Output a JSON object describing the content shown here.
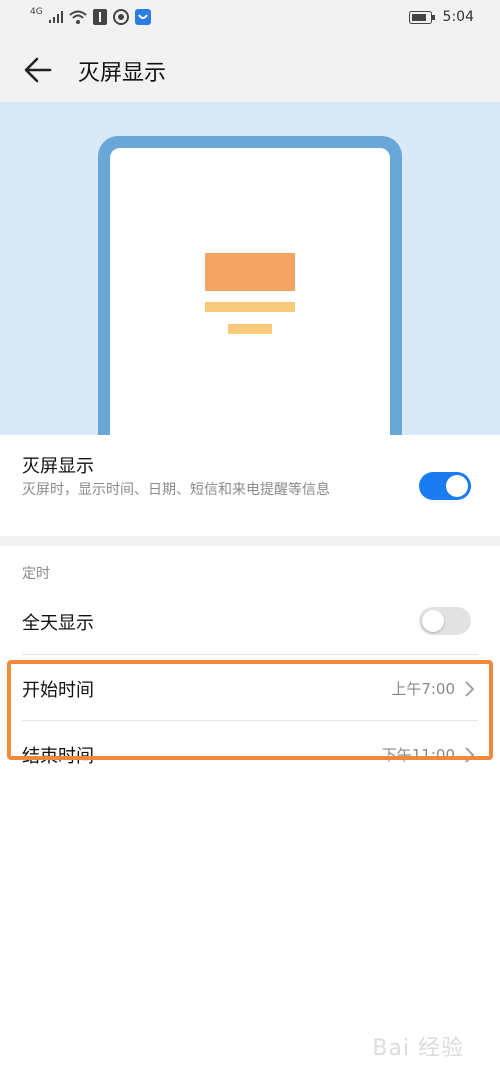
{
  "status_bar": {
    "network": "4G",
    "time": "5:04"
  },
  "header": {
    "title": "灭屏显示",
    "back_icon": "arrow-left-icon"
  },
  "preview": {
    "colors": {
      "background": "#dae9f7",
      "frame": "#69a7d8",
      "block_main": "#f5a563",
      "block_bars": "#f9c97c"
    }
  },
  "aod_setting": {
    "title": "灭屏显示",
    "description": "灭屏时，显示时间、日期、短信和来电提醒等信息",
    "enabled": true
  },
  "schedule": {
    "section_label": "定时",
    "all_day": {
      "label": "全天显示",
      "enabled": false
    },
    "start": {
      "label": "开始时间",
      "value": "上午7:00"
    },
    "end": {
      "label": "结束时间",
      "value": "下午11:00"
    }
  },
  "watermark": "Bai 经验",
  "colors": {
    "accent": "#1a7cf0",
    "highlight": "#f08a3a"
  }
}
